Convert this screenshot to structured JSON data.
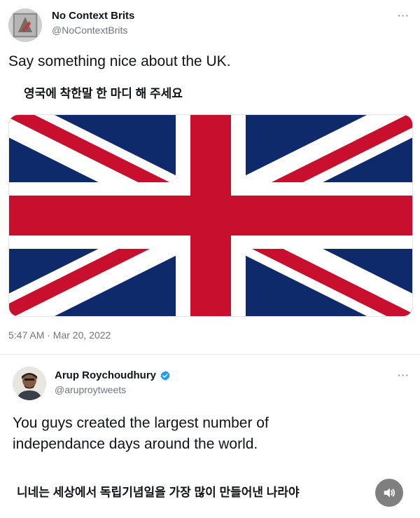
{
  "tweet1": {
    "author_name": "No Context Brits",
    "author_handle": "@NoContextBrits",
    "more_label": "···",
    "text_en": "Say something nice about the UK.",
    "text_ko": "영국에 착한말 한 마디 해 주세요",
    "timestamp": "5:47 AM · Mar 20, 2022",
    "media": {
      "icon": "union-jack-flag",
      "colors": {
        "blue": "#0f2a6b",
        "red": "#c8102e",
        "white": "#ffffff"
      }
    }
  },
  "tweet2": {
    "author_name": "Arup Roychoudhury",
    "author_handle": "@aruproytweets",
    "more_label": "···",
    "verified_icon": "verified-badge-icon",
    "verified_color": "#1d9bf0",
    "text_en_line1": "You guys created the largest number of",
    "text_en_line2": "independance days around the world.",
    "text_ko": "니네는 세상에서 독립기념일을 가장 많이 만들어낸 나라야"
  },
  "sound_button": {
    "icon": "speaker-icon",
    "color": "#7f7f7f"
  }
}
